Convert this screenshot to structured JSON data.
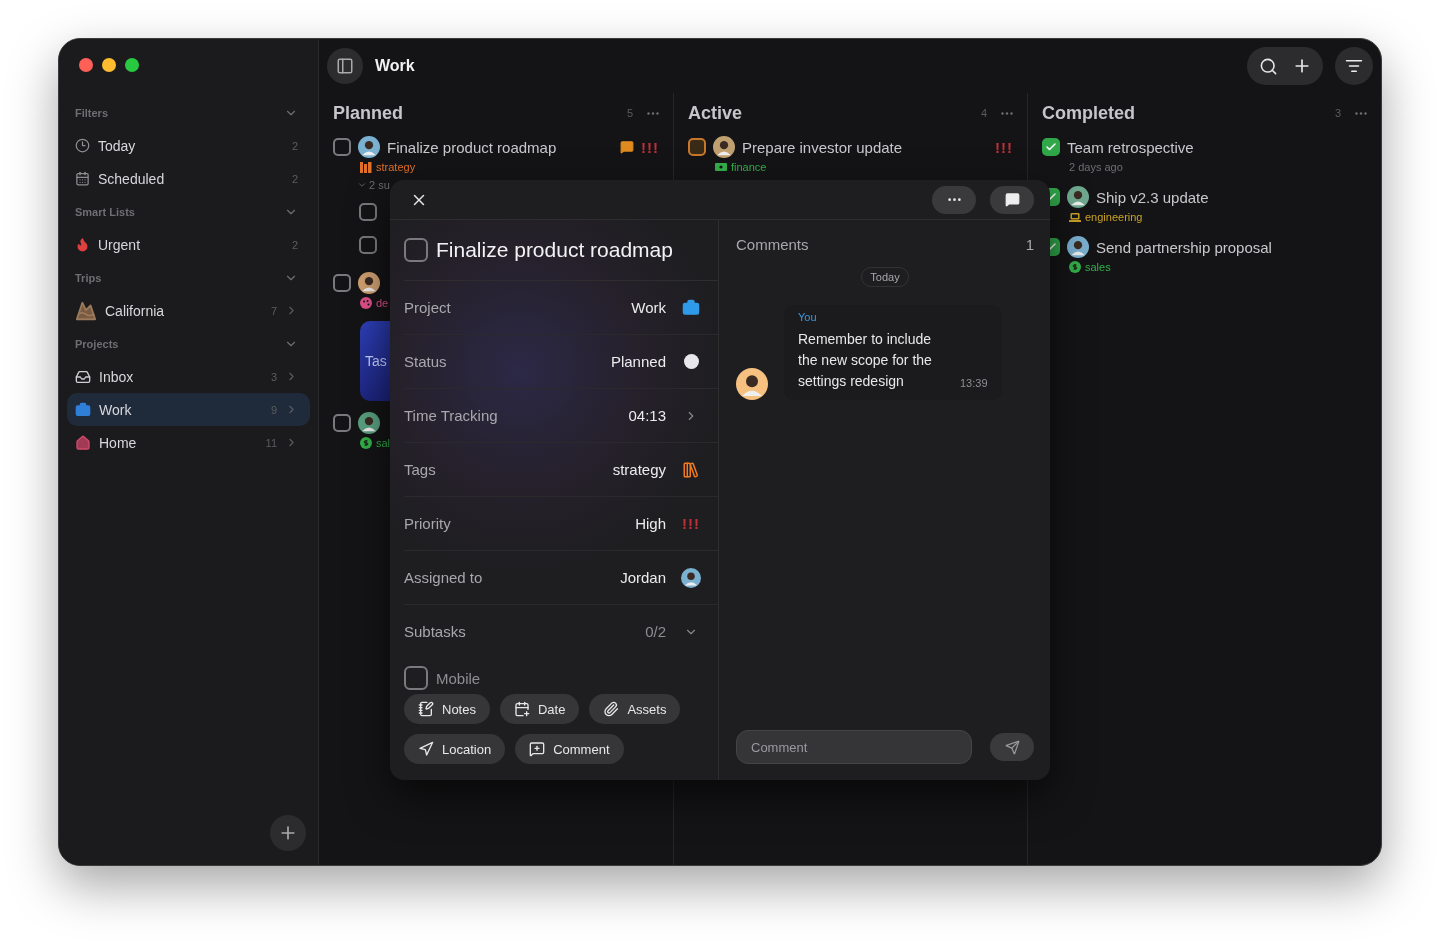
{
  "window": {
    "title": "Work"
  },
  "sidebar": {
    "sections": [
      {
        "title": "Filters",
        "expanded": true,
        "items": [
          {
            "label": "Today",
            "count": "2",
            "selected": false,
            "has_children": false
          },
          {
            "label": "Scheduled",
            "count": "2",
            "selected": false,
            "has_children": false
          }
        ]
      },
      {
        "title": "Smart Lists",
        "expanded": true,
        "items": [
          {
            "label": "Urgent",
            "count": "2",
            "selected": false,
            "has_children": false
          }
        ]
      },
      {
        "title": "Trips",
        "expanded": true,
        "items": [
          {
            "label": "California",
            "count": "7",
            "selected": false,
            "has_children": true
          }
        ]
      },
      {
        "title": "Projects",
        "expanded": true,
        "items": [
          {
            "label": "Inbox",
            "count": "3",
            "selected": false,
            "has_children": true
          },
          {
            "label": "Work",
            "count": "9",
            "selected": true,
            "has_children": true
          },
          {
            "label": "Home",
            "count": "11",
            "selected": false,
            "has_children": true
          }
        ]
      }
    ]
  },
  "columns": [
    {
      "title": "Planned",
      "count": "5",
      "tasks": [
        {
          "kind": "task",
          "title": "Finalize product roadmap",
          "checked": false,
          "in_progress": false,
          "avatar": true,
          "comment": true,
          "priority": "!!!",
          "tag": {
            "label": "strategy",
            "color": "#e0702a"
          },
          "subtasks": {
            "label": "2 su",
            "expanded": true,
            "items": [
              {
                "checked": false
              },
              {
                "checked": false
              }
            ]
          }
        },
        {
          "kind": "task",
          "checked": false,
          "in_progress": false,
          "avatar": true,
          "tag": {
            "label": "de",
            "color": "#e0508a"
          }
        },
        {
          "kind": "card",
          "label": "Tas"
        },
        {
          "kind": "task",
          "checked": false,
          "in_progress": false,
          "avatar": true,
          "tag": {
            "label": "sal",
            "color": "#34b04a"
          }
        }
      ]
    },
    {
      "title": "Active",
      "count": "4",
      "tasks": [
        {
          "kind": "task",
          "title": "Prepare investor update",
          "checked": false,
          "in_progress": true,
          "avatar": true,
          "priority": "!!!",
          "tag": {
            "label": "finance",
            "color": "#34b04a"
          }
        }
      ]
    },
    {
      "title": "Completed",
      "count": "3",
      "tasks": [
        {
          "kind": "task",
          "title": "Team retrospective",
          "checked": true,
          "avatar": false,
          "note": "2 days ago"
        },
        {
          "kind": "task",
          "title": "Ship v2.3 update",
          "checked": true,
          "avatar": true,
          "tag": {
            "label": "engineering",
            "color": "#c9a227"
          }
        },
        {
          "kind": "task",
          "title": "Send partnership proposal",
          "checked": true,
          "avatar": true,
          "tag": {
            "label": "sales",
            "color": "#34b04a"
          }
        }
      ]
    }
  ],
  "detail": {
    "title": "Finalize product roadmap",
    "checked": false,
    "properties": [
      {
        "kind": "project",
        "label": "Project",
        "value": "Work"
      },
      {
        "kind": "status",
        "label": "Status",
        "value": "Planned"
      },
      {
        "kind": "timer",
        "label": "Time Tracking",
        "value": "04:13"
      },
      {
        "kind": "tags",
        "label": "Tags",
        "value": "strategy"
      },
      {
        "kind": "priority",
        "label": "Priority",
        "value": "High",
        "mark": "!!!"
      },
      {
        "kind": "assignee",
        "label": "Assigned to",
        "value": "Jordan"
      },
      {
        "kind": "subtasks",
        "label": "Subtasks",
        "value": "0/2",
        "expanded": true
      }
    ],
    "subtasks": [
      {
        "label": "Mobile",
        "checked": false
      }
    ],
    "actions": [
      "Notes",
      "Date",
      "Assets",
      "Location",
      "Comment"
    ],
    "comments": {
      "title": "Comments",
      "count": "1",
      "day": "Today",
      "items": [
        {
          "author": "You",
          "text": "Remember to include the new scope for the settings redesign",
          "time": "13:39"
        }
      ],
      "placeholder": "Comment"
    }
  }
}
